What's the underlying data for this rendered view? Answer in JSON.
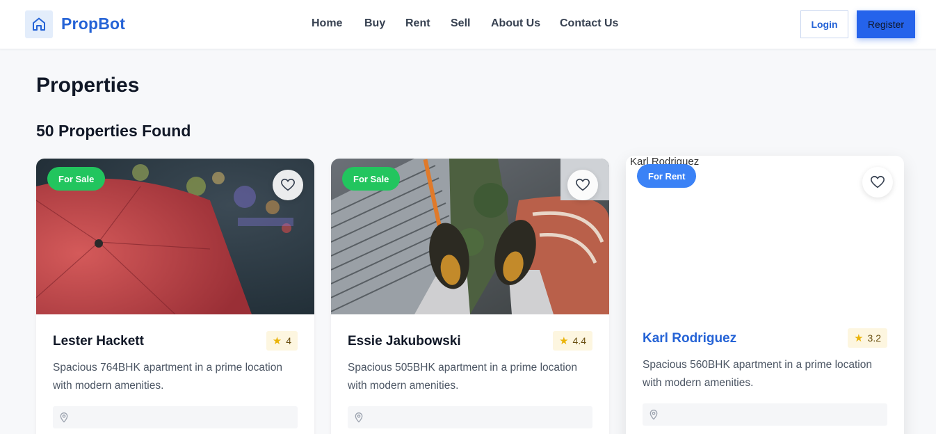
{
  "header": {
    "brand": "PropBot",
    "logo_icon": "home-icon",
    "nav": [
      "Home",
      "Buy",
      "Rent",
      "Sell",
      "About Us",
      "Contact Us"
    ],
    "login_label": "Login",
    "register_label": "Register",
    "accent_color": "#2563eb"
  },
  "main": {
    "title": "Properties",
    "results_count": "50 Properties Found"
  },
  "cards": [
    {
      "badge": "For Sale",
      "badge_color": "#22c55e",
      "title": "Lester Hackett",
      "rating": "4",
      "description": "Spacious 764BHK apartment in a prime location with modern amenities.",
      "image": "red umbrella in rain with city lights"
    },
    {
      "badge": "For Sale",
      "badge_color": "#22c55e",
      "title": "Essie Jakubowski",
      "rating": "4.4",
      "description": "Spacious 505BHK apartment in a prime location with modern amenities.",
      "image": "feet in sneakers dangling above city buildings"
    },
    {
      "badge": "For Rent",
      "badge_color": "#3b82f6",
      "title": "Karl Rodriguez",
      "image_alt": "Karl Rodriguez",
      "rating": "3.2",
      "description": "Spacious 560BHK apartment in a prime location with modern amenities."
    }
  ]
}
